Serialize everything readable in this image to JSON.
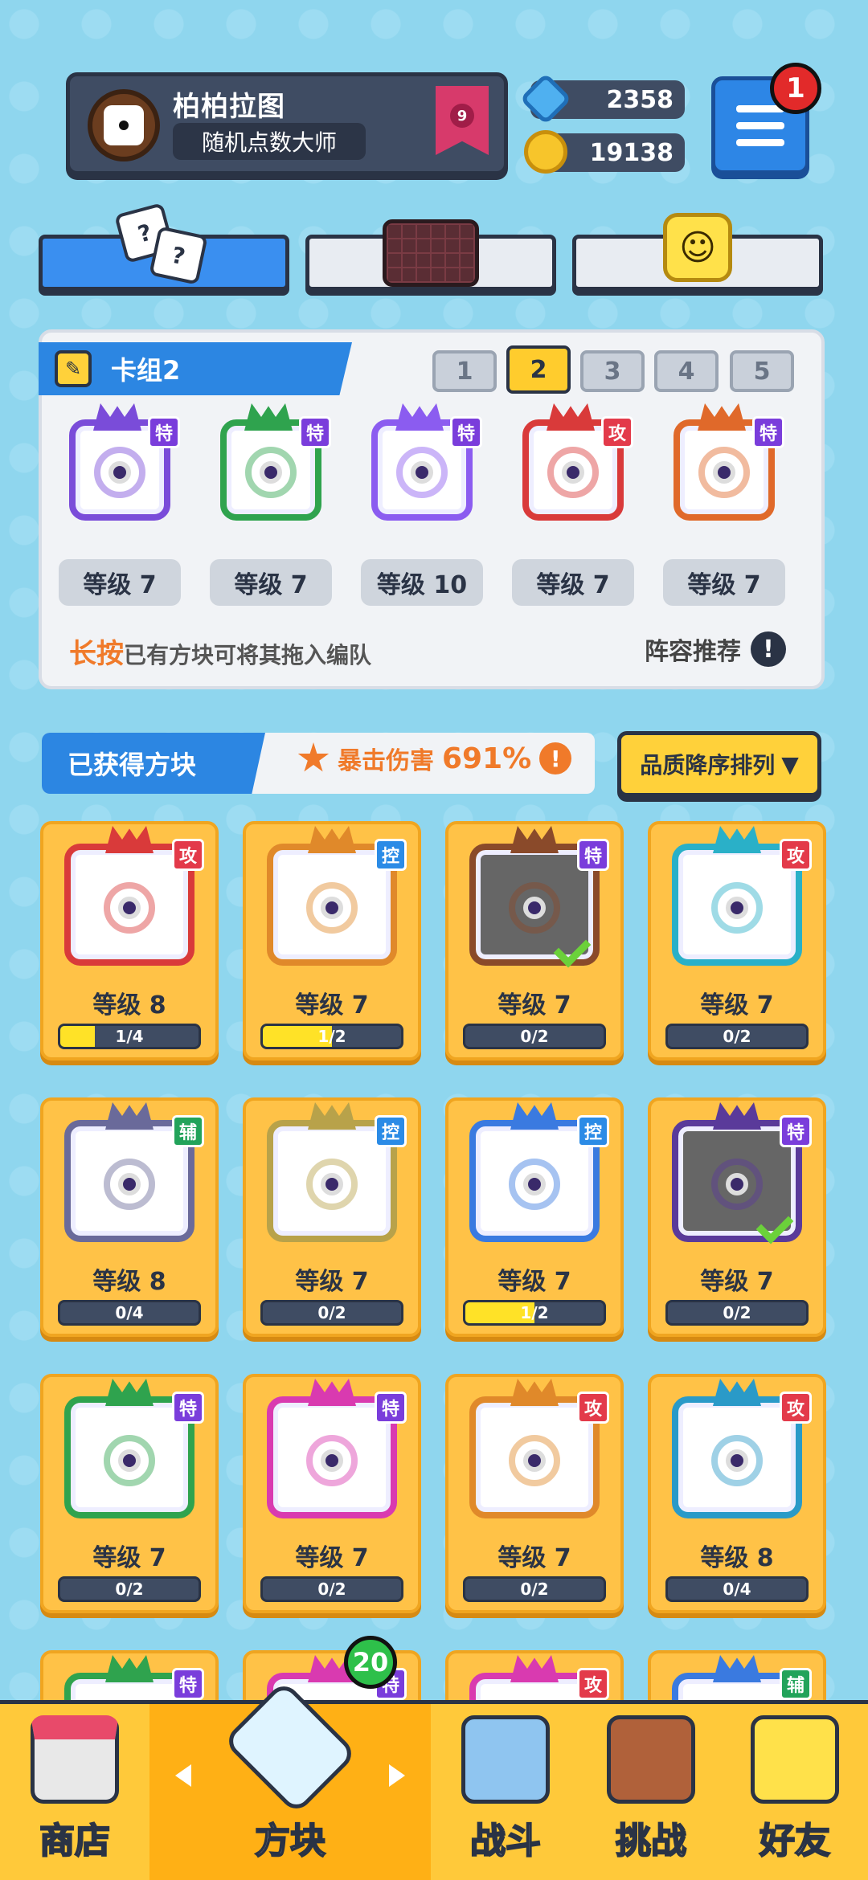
{
  "header": {
    "player_name": "柏柏拉图",
    "player_title": "随机点数大师",
    "rank_level": "9",
    "gems": "2358",
    "coins": "19138",
    "notification_count": "1"
  },
  "deck": {
    "label": "卡组2",
    "deck_numbers": [
      "1",
      "2",
      "3",
      "4",
      "5"
    ],
    "selected_deck": "2",
    "cards": [
      {
        "tag": "特",
        "level": "等级 7",
        "color": "#7a4cd9"
      },
      {
        "tag": "特",
        "level": "等级 7",
        "color": "#2fa34e"
      },
      {
        "tag": "特",
        "level": "等级 10",
        "color": "#8b5cf0"
      },
      {
        "tag": "攻",
        "level": "等级 7",
        "color": "#d93a3a"
      },
      {
        "tag": "特",
        "level": "等级 7",
        "color": "#e0692a"
      }
    ],
    "hint_strong": "长按",
    "hint_text": "已有方块可将其拖入编队",
    "recommend_label": "阵容推荐",
    "recommend_icon": "!"
  },
  "owned": {
    "label": "已获得方块",
    "crit_label": "暴击伤害",
    "crit_value": "691%",
    "crit_icon": "!",
    "sort_label": "品质降序排列"
  },
  "grid": [
    {
      "tag": "攻",
      "level": "等级 8",
      "progress": "1/4",
      "fill": 0.25,
      "color": "#d93a3a",
      "checked": false,
      "dim": false
    },
    {
      "tag": "控",
      "level": "等级 7",
      "progress": "1/2",
      "fill": 0.5,
      "color": "#e0892a",
      "checked": false,
      "dim": false
    },
    {
      "tag": "特",
      "level": "等级 7",
      "progress": "0/2",
      "fill": 0,
      "color": "#8a4a2a",
      "checked": true,
      "dim": true
    },
    {
      "tag": "攻",
      "level": "等级 7",
      "progress": "0/2",
      "fill": 0,
      "color": "#2ab0c8",
      "checked": false,
      "dim": false
    },
    {
      "tag": "辅",
      "level": "等级 8",
      "progress": "0/4",
      "fill": 0,
      "color": "#6a6a9a",
      "checked": false,
      "dim": false
    },
    {
      "tag": "控",
      "level": "等级 7",
      "progress": "0/2",
      "fill": 0,
      "color": "#b8a24a",
      "checked": false,
      "dim": false
    },
    {
      "tag": "控",
      "level": "等级 7",
      "progress": "1/2",
      "fill": 0.5,
      "color": "#3a7ae0",
      "checked": false,
      "dim": false
    },
    {
      "tag": "特",
      "level": "等级 7",
      "progress": "0/2",
      "fill": 0,
      "color": "#5a3a9a",
      "checked": true,
      "dim": true
    },
    {
      "tag": "特",
      "level": "等级 7",
      "progress": "0/2",
      "fill": 0,
      "color": "#2fa34e",
      "checked": false,
      "dim": false
    },
    {
      "tag": "特",
      "level": "等级 7",
      "progress": "0/2",
      "fill": 0,
      "color": "#d93ab0",
      "checked": false,
      "dim": false
    },
    {
      "tag": "攻",
      "level": "等级 7",
      "progress": "0/2",
      "fill": 0,
      "color": "#e0892a",
      "checked": false,
      "dim": false
    },
    {
      "tag": "攻",
      "level": "等级 8",
      "progress": "0/4",
      "fill": 0,
      "color": "#2a9ac8",
      "checked": false,
      "dim": false
    },
    {
      "tag": "特",
      "color": "#2fa34e"
    },
    {
      "tag": "特",
      "color": "#d93ab0"
    },
    {
      "tag": "攻",
      "color": "#d93ab0"
    },
    {
      "tag": "辅",
      "color": "#3a7ae0"
    }
  ],
  "nav": {
    "items": [
      "商店",
      "方块",
      "战斗",
      "挑战",
      "好友"
    ],
    "selected": "方块",
    "cube_badge": "20"
  },
  "colors": {
    "accent_blue": "#2c86e2",
    "card_gold": "#ffc247",
    "orange": "#f07a2a",
    "progress_yellow": "#ffe227"
  }
}
